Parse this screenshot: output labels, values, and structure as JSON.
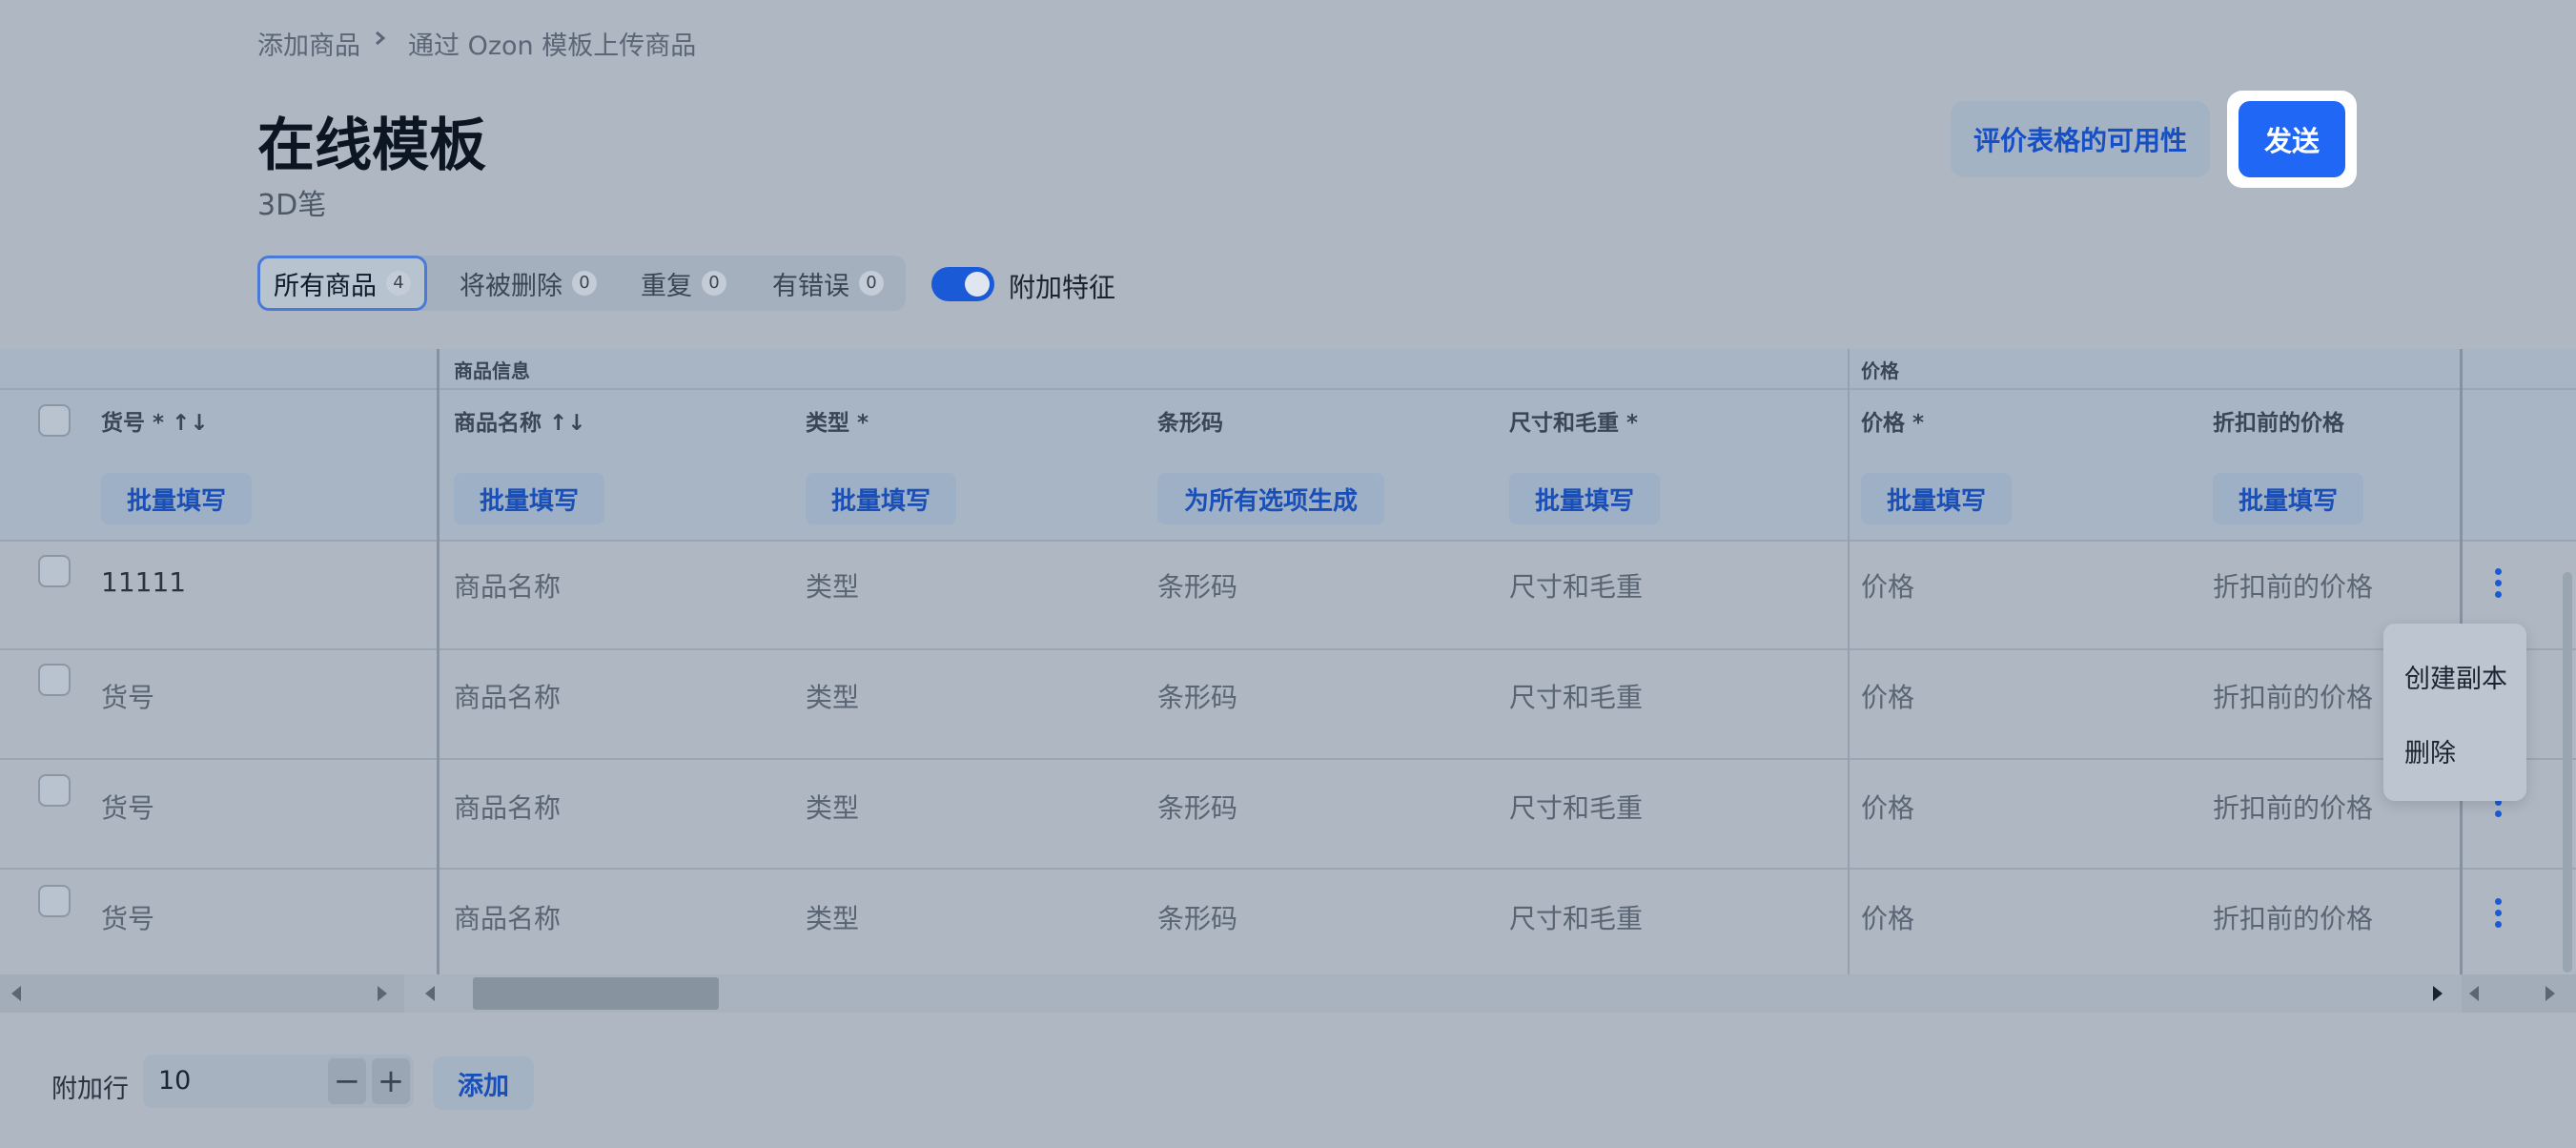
{
  "breadcrumb": {
    "parent": "添加商品",
    "current": "通过 Ozon 模板上传商品"
  },
  "page": {
    "title": "在线模板",
    "subtitle": "3D笔"
  },
  "actions": {
    "evaluate_label": "评价表格的可用性",
    "send_label": "发送"
  },
  "filters": {
    "tabs": [
      {
        "label": "所有商品",
        "count": "4"
      },
      {
        "label": "将被删除",
        "count": "0"
      },
      {
        "label": "重复",
        "count": "0"
      },
      {
        "label": "有错误",
        "count": "0"
      }
    ],
    "toggle_label": "附加特征",
    "toggle_on": true
  },
  "table": {
    "groups": {
      "product_info": "商品信息",
      "price": "价格"
    },
    "columns": [
      {
        "label": "货号 *",
        "sort": "↑↓",
        "bulk": "批量填写"
      },
      {
        "label": "商品名称",
        "sort": "↑↓",
        "bulk": "批量填写"
      },
      {
        "label": "类型 *",
        "sort": "",
        "bulk": "批量填写"
      },
      {
        "label": "条形码",
        "sort": "",
        "bulk": "为所有选项生成"
      },
      {
        "label": "尺寸和毛重 *",
        "sort": "",
        "bulk": "批量填写"
      },
      {
        "label": "价格 *",
        "sort": "",
        "bulk": "批量填写"
      },
      {
        "label": "折扣前的价格",
        "sort": "",
        "bulk": "批量填写"
      }
    ],
    "rows": [
      [
        "11111",
        "商品名称",
        "类型",
        "条形码",
        "尺寸和毛重",
        "价格",
        "折扣前的价格"
      ],
      [
        "货号",
        "商品名称",
        "类型",
        "条形码",
        "尺寸和毛重",
        "价格",
        "折扣前的价格"
      ],
      [
        "货号",
        "商品名称",
        "类型",
        "条形码",
        "尺寸和毛重",
        "价格",
        "折扣前的价格"
      ],
      [
        "货号",
        "商品名称",
        "类型",
        "条形码",
        "尺寸和毛重",
        "价格",
        "折扣前的价格"
      ]
    ]
  },
  "row_menu": {
    "items": [
      "创建副本",
      "删除"
    ]
  },
  "footer": {
    "label": "附加行",
    "value": "10",
    "minus": "−",
    "plus": "+",
    "add_label": "添加"
  },
  "colors": {
    "accent": "#1f67f4",
    "link": "#1a4fb8",
    "background": "#aeb7c2"
  }
}
